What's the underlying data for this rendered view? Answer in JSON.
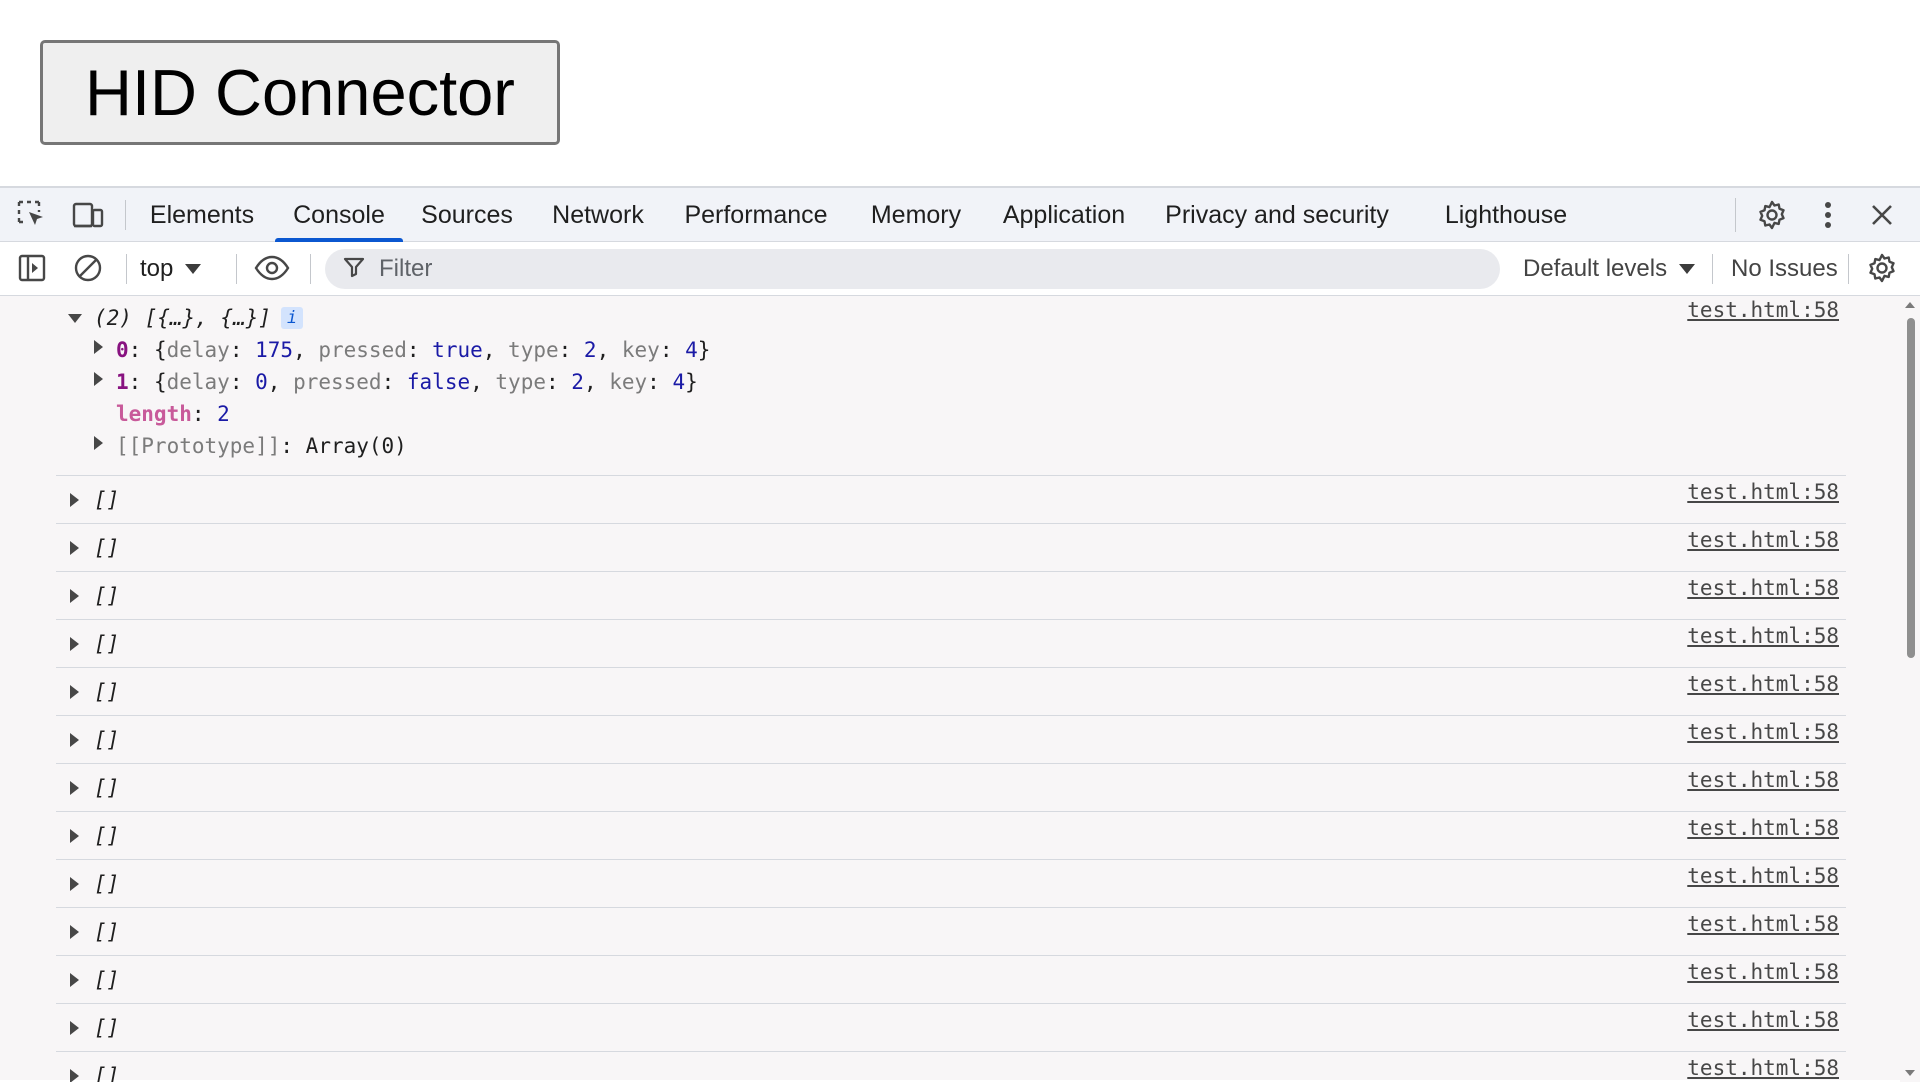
{
  "page": {
    "button_label": "HID Connector"
  },
  "devtools": {
    "tabs": [
      {
        "label": "Elements"
      },
      {
        "label": "Console",
        "active": true
      },
      {
        "label": "Sources"
      },
      {
        "label": "Network"
      },
      {
        "label": "Performance"
      },
      {
        "label": "Memory"
      },
      {
        "label": "Application"
      },
      {
        "label": "Privacy and security"
      },
      {
        "label": "Lighthouse"
      }
    ],
    "toolbar": {
      "context": "top",
      "filter_placeholder": "Filter",
      "levels": "Default levels",
      "issues": "No Issues"
    },
    "icons": {
      "inspect": "inspect-element-icon",
      "device": "device-toolbar-icon",
      "settings": "gear-icon",
      "more": "more-vertical-icon",
      "close": "close-icon",
      "sidebar": "sidebar-toggle-icon",
      "clear": "clear-console-icon",
      "eye": "live-expression-eye-icon",
      "filter": "filter-icon",
      "console_settings": "console-settings-gear-icon"
    },
    "accent_color": "#0b57d0"
  },
  "console": {
    "first_message": {
      "summary": "(2) [{…}, {…}]",
      "info_badge": "i",
      "source": "test.html:58",
      "entries": [
        {
          "index": "0",
          "colon": ": ",
          "open": "{",
          "delay_key": "delay",
          "delay_val": "175",
          "pressed_key": "pressed",
          "pressed_val": "true",
          "type_key": "type",
          "type_val": "2",
          "key_key": "key",
          "key_val": "4",
          "close": "}"
        },
        {
          "index": "1",
          "colon": ": ",
          "open": "{",
          "delay_key": "delay",
          "delay_val": "0",
          "pressed_key": "pressed",
          "pressed_val": "false",
          "type_key": "type",
          "type_val": "2",
          "key_key": "key",
          "key_val": "4",
          "close": "}"
        }
      ],
      "length_key": "length",
      "length_val": "2",
      "prototype_key": "[[Prototype]]",
      "prototype_val": "Array(0)"
    },
    "messages": [
      {
        "text": "[]",
        "source": "test.html:58"
      },
      {
        "text": "[]",
        "source": "test.html:58"
      },
      {
        "text": "[]",
        "source": "test.html:58"
      },
      {
        "text": "[]",
        "source": "test.html:58"
      },
      {
        "text": "[]",
        "source": "test.html:58"
      },
      {
        "text": "[]",
        "source": "test.html:58"
      },
      {
        "text": "[]",
        "source": "test.html:58"
      },
      {
        "text": "[]",
        "source": "test.html:58"
      },
      {
        "text": "[]",
        "source": "test.html:58"
      },
      {
        "text": "[]",
        "source": "test.html:58"
      },
      {
        "text": "[]",
        "source": "test.html:58"
      },
      {
        "text": "[]",
        "source": "test.html:58"
      },
      {
        "text": "[]",
        "source": "test.html:58"
      }
    ]
  }
}
